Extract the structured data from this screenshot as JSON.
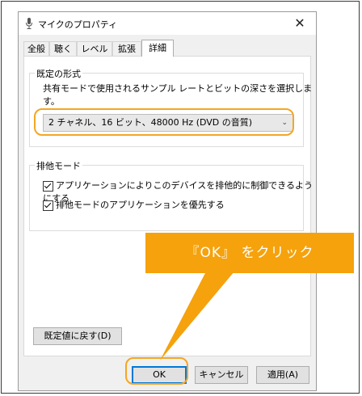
{
  "window": {
    "title": "マイクのプロパティ",
    "close_symbol": "✕"
  },
  "tabs": [
    {
      "label": "全般",
      "active": false
    },
    {
      "label": "聴く",
      "active": false
    },
    {
      "label": "レベル",
      "active": false
    },
    {
      "label": "拡張",
      "active": false
    },
    {
      "label": "詳細",
      "active": true
    }
  ],
  "default_format": {
    "group_title": "既定の形式",
    "description": "共有モードで使用されるサンプル レートとビットの深さを選択します。",
    "selected_value": "2 チャネル、16 ビット、48000 Hz (DVD の音質)",
    "chevron": "⌄"
  },
  "exclusive_mode": {
    "group_title": "排他モード",
    "options": [
      {
        "label": "アプリケーションによりこのデバイスを排他的に制御できるようにする",
        "checked": true
      },
      {
        "label": "排他モードのアプリケーションを優先する",
        "checked": true
      }
    ]
  },
  "buttons": {
    "restore_defaults": "既定値に戻す(D)",
    "ok": "OK",
    "cancel": "キャンセル",
    "apply": "適用(A)"
  },
  "annotation": {
    "callout_text": "『OK』 をクリック",
    "color": "#f5a20c"
  },
  "icons": {
    "title_icon": "microphone-icon",
    "close_icon": "close-icon",
    "chevron": "chevron-down-icon"
  }
}
